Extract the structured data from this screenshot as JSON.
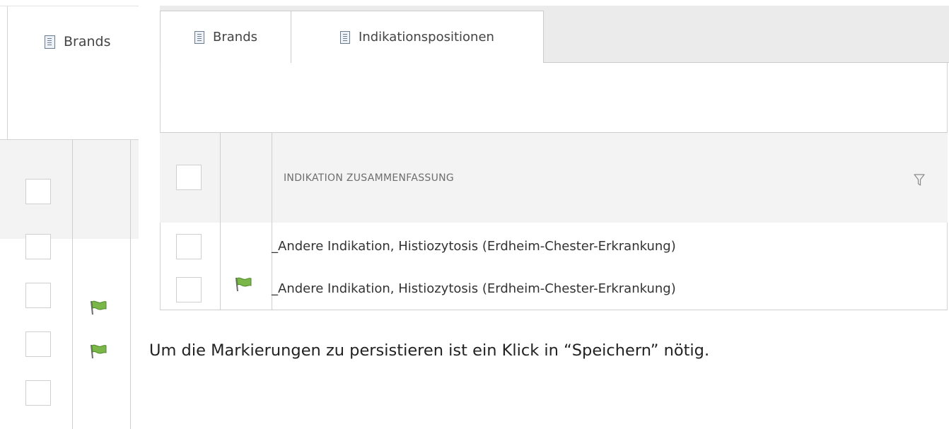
{
  "left_panel": {
    "tab": {
      "label": "Brands",
      "icon": "document-list-icon"
    },
    "rows": [
      {
        "checked": false,
        "flagged": false
      },
      {
        "checked": false,
        "flagged": true
      },
      {
        "checked": false,
        "flagged": true
      },
      {
        "checked": false,
        "flagged": false
      }
    ]
  },
  "main_panel": {
    "tabs": [
      {
        "label": "Brands",
        "icon": "document-list-icon",
        "active": false
      },
      {
        "label": "Indikationspositionen",
        "icon": "document-list-icon",
        "active": true
      }
    ],
    "grid": {
      "columns": [
        {
          "key": "select",
          "label": ""
        },
        {
          "key": "flag",
          "label": ""
        },
        {
          "key": "summary",
          "label": "INDIKATION ZUSAMMENFASSUNG",
          "filter_icon": "filter-icon"
        }
      ],
      "rows": [
        {
          "checked": false,
          "flagged": false,
          "summary": "_Andere Indikation, Histiozytosis (Erdheim-Chester-Erkrankung)"
        },
        {
          "checked": false,
          "flagged": true,
          "summary": "_Andere Indikation, Histiozytosis (Erdheim-Chester-Erkrankung)"
        }
      ]
    }
  },
  "note": "Um die Markierungen zu persistieren ist ein Klick in “Speichern” nötig.",
  "colors": {
    "flag_green": "#7ab648",
    "border": "#cfcfcf",
    "header_bg": "#f3f3f3",
    "tabbar_bg": "#ebebeb"
  }
}
